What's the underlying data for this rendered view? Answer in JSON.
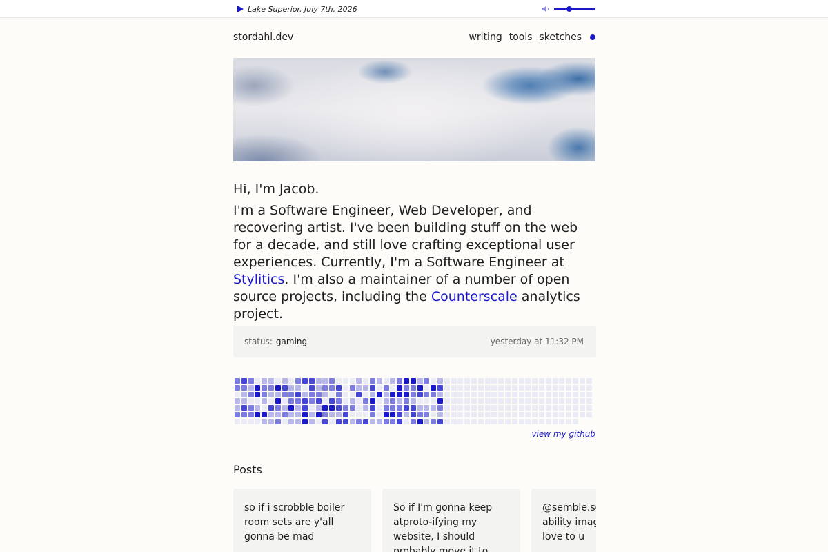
{
  "player": {
    "track": "Lake Superior, July 7th, 2026",
    "volume": 0.35
  },
  "header": {
    "site_name": "stordahl.dev",
    "nav": [
      "writing",
      "tools",
      "sketches"
    ]
  },
  "intro": {
    "greeting": "Hi, I'm Jacob.",
    "text_1": "I'm a Software Engineer, Web Developer, and recovering artist. I've been building stuff on the web for a decade, and still love crafting exceptional user experiences. Currently, I'm a Software Engineer at ",
    "link_1": "Stylitics",
    "text_2": ". I'm also a maintainer of a number of open source projects, including the ",
    "link_2": "Counterscale",
    "text_3": " analytics project."
  },
  "status": {
    "label": "status:",
    "value": "gaming",
    "time": "yesterday at 11:32 PM"
  },
  "contributions": {
    "colors": [
      "#ebebf5",
      "#b7b7ea",
      "#7d7de0",
      "#4545d6",
      "#1a19c9"
    ],
    "link": "view my github"
  },
  "posts": {
    "title": "Posts",
    "items": [
      "so if i scrobble boiler room sets are y'all gonna be mad",
      "So if I'm gonna keep atproto-ifying my website, I should probably move it to",
      "@semble.so add the ability image file up I'd love to u"
    ]
  }
}
